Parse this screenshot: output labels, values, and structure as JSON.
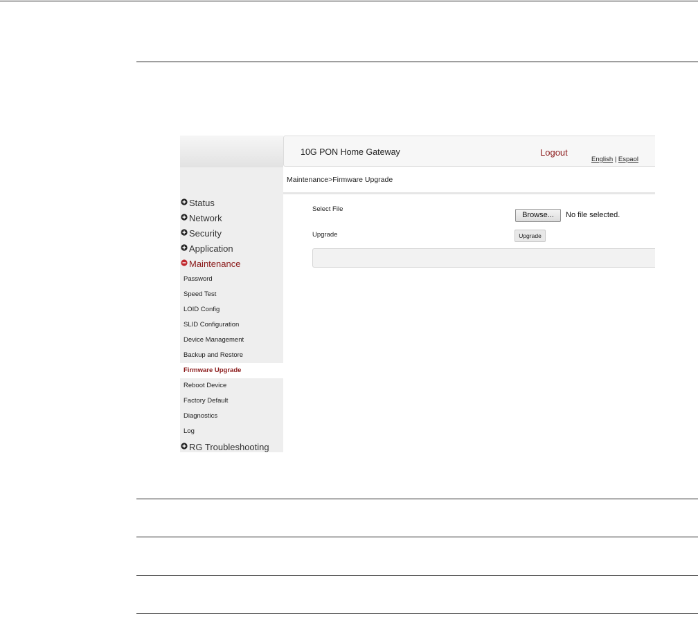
{
  "header": {
    "app_title": "10G PON Home Gateway",
    "logout_label": "Logout",
    "lang_english": "English",
    "lang_separator": "|",
    "lang_spanish": "Espaol"
  },
  "breadcrumb": "Maintenance>Firmware Upgrade",
  "sidebar": {
    "categories_top": [
      {
        "label": "Status"
      },
      {
        "label": "Network"
      },
      {
        "label": "Security"
      },
      {
        "label": "Application"
      }
    ],
    "active_category": "Maintenance",
    "subitems": [
      "Password",
      "Speed Test",
      "LOID Config",
      "SLID Configuration",
      "Device Management",
      "Backup and Restore",
      "Firmware Upgrade",
      "Reboot Device",
      "Factory Default",
      "Diagnostics",
      "Log"
    ],
    "active_subitem": "Firmware Upgrade",
    "category_bottom": "RG Troubleshooting"
  },
  "form": {
    "select_file_label": "Select File",
    "browse_label": "Browse...",
    "no_file_text": "No file selected.",
    "upgrade_label": "Upgrade",
    "upgrade_button": "Upgrade"
  },
  "colors": {
    "accent": "#8b1a1a",
    "sidebar_bg": "#eeeeee",
    "header_bg": "#f7f7f7"
  },
  "icons": {
    "expand": "plus-circle-icon",
    "collapse": "minus-circle-icon"
  }
}
